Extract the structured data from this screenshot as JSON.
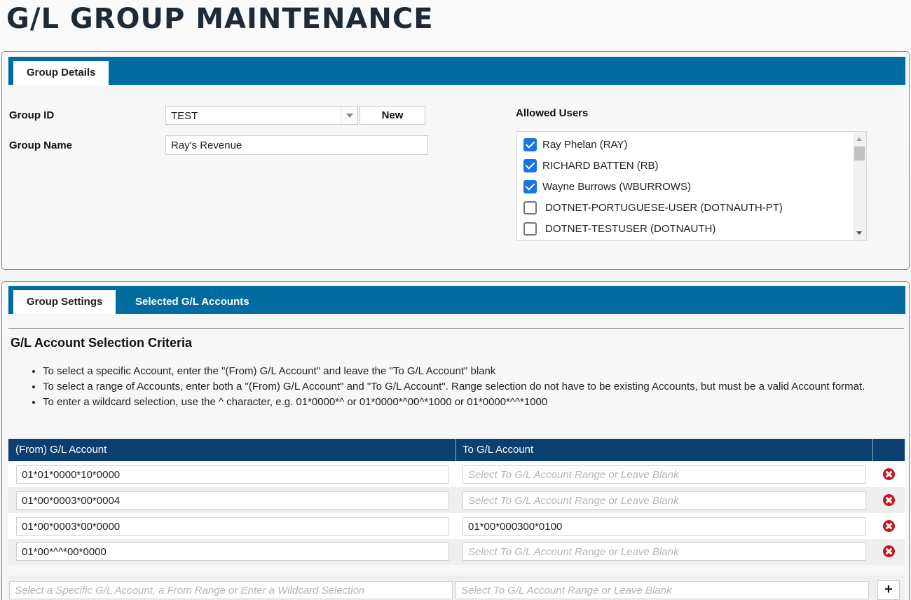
{
  "page_title": "G/L GROUP MAINTENANCE",
  "details": {
    "tab_label": "Group Details",
    "group_id_label": "Group ID",
    "group_id_value": "TEST",
    "new_button": "New",
    "group_name_label": "Group Name",
    "group_name_value": "Ray's Revenue",
    "allowed_users_label": "Allowed Users",
    "users": [
      {
        "name": "Ray Phelan (RAY)",
        "checked": true
      },
      {
        "name": "RICHARD BATTEN (RB)",
        "checked": true
      },
      {
        "name": "Wayne Burrows (WBURROWS)",
        "checked": true
      },
      {
        "name": "DOTNET-PORTUGUESE-USER (DOTNAUTH-PT)",
        "checked": false
      },
      {
        "name": "DOTNET-TESTUSER (DOTNAUTH)",
        "checked": false
      }
    ]
  },
  "settings": {
    "tabs": [
      {
        "label": "Group Settings",
        "active": true
      },
      {
        "label": "Selected G/L Accounts",
        "active": false
      }
    ],
    "section_title": "G/L Account Selection Criteria",
    "bullets": [
      "To select a specific Account, enter the \"(From) G/L Account\" and leave the \"To G/L Account\" blank",
      "To select a range of Accounts, enter both a \"(From) G/L Account\" and \"To G/L Account\". Range selection do not have to be existing Accounts, but must be a valid Account format.",
      "To enter a wildcard selection, use the ^ character, e.g. 01*0000*^ or 01*0000*^00^*1000 or 01*0000*^^*1000"
    ],
    "grid": {
      "columns": [
        "(From) G/L Account",
        "To G/L Account",
        ""
      ],
      "to_placeholder": "Select To G/L Account Range or Leave Blank",
      "rows": [
        {
          "from": "01*01*0000*10*0000",
          "to": ""
        },
        {
          "from": "01*00*0003*00*0004",
          "to": ""
        },
        {
          "from": "01*00*0003*00*0000",
          "to": "01*00*000300*0100"
        },
        {
          "from": "01*00*^^*00*0000",
          "to": ""
        }
      ]
    },
    "new_row": {
      "from_placeholder": "Select a Specific G/L Account, a From Range or Enter a Wildcard Selection",
      "to_placeholder": "Select To G/L Account Range or Leave Blank",
      "add_label": "+"
    }
  },
  "colors": {
    "tab_bar": "#016ca0",
    "grid_header": "#0b3f70",
    "checkbox_checked": "#1a73e8",
    "delete_icon": "#c9151f"
  }
}
